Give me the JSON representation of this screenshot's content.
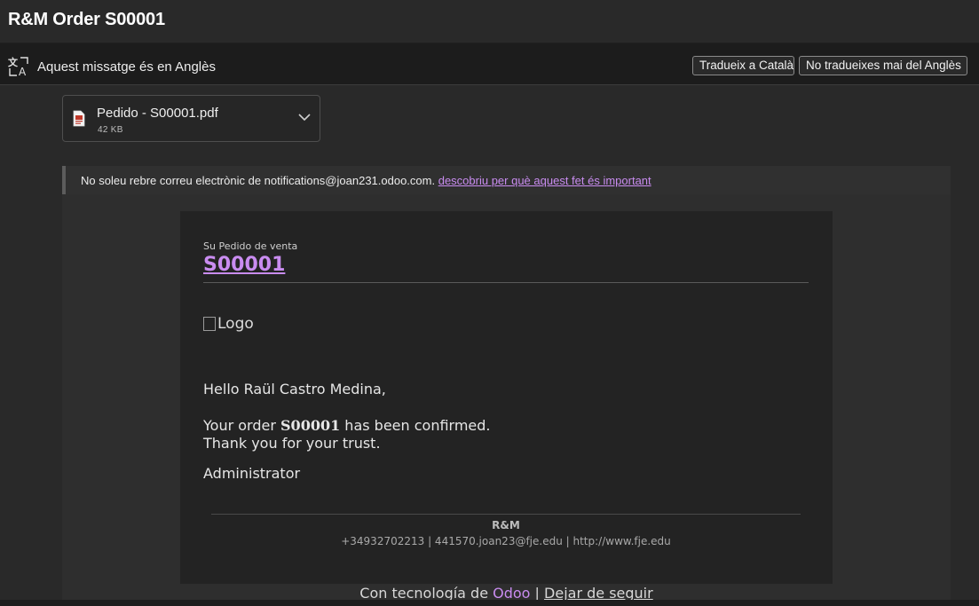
{
  "subject": "R&M Order S00001",
  "translate_bar": {
    "message": "Aquest missatge és en Anglès",
    "translate_button": "Tradueix a Català",
    "never_button": "No tradueixes mai del Anglès",
    "icon": "translate-icon"
  },
  "attachment": {
    "name": "Pedido - S00001.pdf",
    "size": "42 KB",
    "icon": "pdf-file-icon"
  },
  "warning": {
    "text": "No soleu rebre correu electrònic de notifications@joan231.odoo.com.",
    "link": "descobriu per què aquest fet és important"
  },
  "email": {
    "eyebrow": "Su Pedido de venta",
    "order_number": "S00001",
    "logo_alt": "Logo",
    "greeting": "Hello Raül Castro Medina,",
    "line1_prefix": "Your order ",
    "line1_order": "S00001",
    "line1_suffix": " has been confirmed.",
    "line2": "Thank you for your trust.",
    "signature": "Administrator",
    "footer_company": "R&M",
    "footer_contact": "+34932702213 | 441570.joan23@fje.edu | http://www.fje.edu"
  },
  "powered": {
    "prefix": "Con tecnología de ",
    "brand": "Odoo",
    "separator": " | ",
    "unfollow": "Dejar de seguir"
  },
  "colors": {
    "accent_link": "#c98cf0",
    "background": "#292929",
    "card": "#232323"
  }
}
